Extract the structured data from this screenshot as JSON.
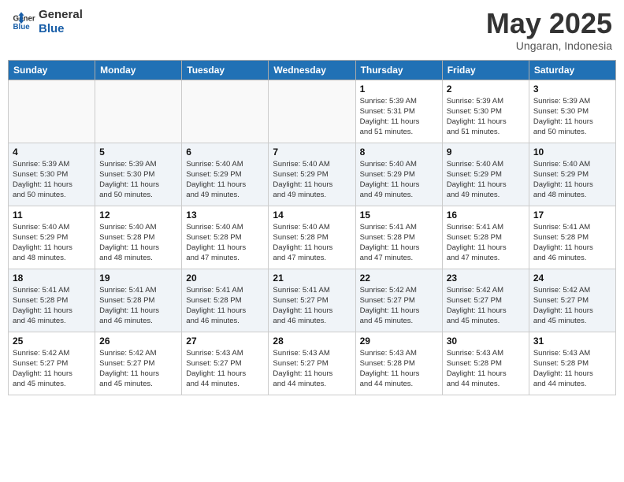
{
  "header": {
    "logo_line1": "General",
    "logo_line2": "Blue",
    "month": "May 2025",
    "location": "Ungaran, Indonesia"
  },
  "weekdays": [
    "Sunday",
    "Monday",
    "Tuesday",
    "Wednesday",
    "Thursday",
    "Friday",
    "Saturday"
  ],
  "weeks": [
    [
      {
        "day": "",
        "info": ""
      },
      {
        "day": "",
        "info": ""
      },
      {
        "day": "",
        "info": ""
      },
      {
        "day": "",
        "info": ""
      },
      {
        "day": "1",
        "info": "Sunrise: 5:39 AM\nSunset: 5:31 PM\nDaylight: 11 hours\nand 51 minutes."
      },
      {
        "day": "2",
        "info": "Sunrise: 5:39 AM\nSunset: 5:30 PM\nDaylight: 11 hours\nand 51 minutes."
      },
      {
        "day": "3",
        "info": "Sunrise: 5:39 AM\nSunset: 5:30 PM\nDaylight: 11 hours\nand 50 minutes."
      }
    ],
    [
      {
        "day": "4",
        "info": "Sunrise: 5:39 AM\nSunset: 5:30 PM\nDaylight: 11 hours\nand 50 minutes."
      },
      {
        "day": "5",
        "info": "Sunrise: 5:39 AM\nSunset: 5:30 PM\nDaylight: 11 hours\nand 50 minutes."
      },
      {
        "day": "6",
        "info": "Sunrise: 5:40 AM\nSunset: 5:29 PM\nDaylight: 11 hours\nand 49 minutes."
      },
      {
        "day": "7",
        "info": "Sunrise: 5:40 AM\nSunset: 5:29 PM\nDaylight: 11 hours\nand 49 minutes."
      },
      {
        "day": "8",
        "info": "Sunrise: 5:40 AM\nSunset: 5:29 PM\nDaylight: 11 hours\nand 49 minutes."
      },
      {
        "day": "9",
        "info": "Sunrise: 5:40 AM\nSunset: 5:29 PM\nDaylight: 11 hours\nand 49 minutes."
      },
      {
        "day": "10",
        "info": "Sunrise: 5:40 AM\nSunset: 5:29 PM\nDaylight: 11 hours\nand 48 minutes."
      }
    ],
    [
      {
        "day": "11",
        "info": "Sunrise: 5:40 AM\nSunset: 5:29 PM\nDaylight: 11 hours\nand 48 minutes."
      },
      {
        "day": "12",
        "info": "Sunrise: 5:40 AM\nSunset: 5:28 PM\nDaylight: 11 hours\nand 48 minutes."
      },
      {
        "day": "13",
        "info": "Sunrise: 5:40 AM\nSunset: 5:28 PM\nDaylight: 11 hours\nand 47 minutes."
      },
      {
        "day": "14",
        "info": "Sunrise: 5:40 AM\nSunset: 5:28 PM\nDaylight: 11 hours\nand 47 minutes."
      },
      {
        "day": "15",
        "info": "Sunrise: 5:41 AM\nSunset: 5:28 PM\nDaylight: 11 hours\nand 47 minutes."
      },
      {
        "day": "16",
        "info": "Sunrise: 5:41 AM\nSunset: 5:28 PM\nDaylight: 11 hours\nand 47 minutes."
      },
      {
        "day": "17",
        "info": "Sunrise: 5:41 AM\nSunset: 5:28 PM\nDaylight: 11 hours\nand 46 minutes."
      }
    ],
    [
      {
        "day": "18",
        "info": "Sunrise: 5:41 AM\nSunset: 5:28 PM\nDaylight: 11 hours\nand 46 minutes."
      },
      {
        "day": "19",
        "info": "Sunrise: 5:41 AM\nSunset: 5:28 PM\nDaylight: 11 hours\nand 46 minutes."
      },
      {
        "day": "20",
        "info": "Sunrise: 5:41 AM\nSunset: 5:28 PM\nDaylight: 11 hours\nand 46 minutes."
      },
      {
        "day": "21",
        "info": "Sunrise: 5:41 AM\nSunset: 5:27 PM\nDaylight: 11 hours\nand 46 minutes."
      },
      {
        "day": "22",
        "info": "Sunrise: 5:42 AM\nSunset: 5:27 PM\nDaylight: 11 hours\nand 45 minutes."
      },
      {
        "day": "23",
        "info": "Sunrise: 5:42 AM\nSunset: 5:27 PM\nDaylight: 11 hours\nand 45 minutes."
      },
      {
        "day": "24",
        "info": "Sunrise: 5:42 AM\nSunset: 5:27 PM\nDaylight: 11 hours\nand 45 minutes."
      }
    ],
    [
      {
        "day": "25",
        "info": "Sunrise: 5:42 AM\nSunset: 5:27 PM\nDaylight: 11 hours\nand 45 minutes."
      },
      {
        "day": "26",
        "info": "Sunrise: 5:42 AM\nSunset: 5:27 PM\nDaylight: 11 hours\nand 45 minutes."
      },
      {
        "day": "27",
        "info": "Sunrise: 5:43 AM\nSunset: 5:27 PM\nDaylight: 11 hours\nand 44 minutes."
      },
      {
        "day": "28",
        "info": "Sunrise: 5:43 AM\nSunset: 5:27 PM\nDaylight: 11 hours\nand 44 minutes."
      },
      {
        "day": "29",
        "info": "Sunrise: 5:43 AM\nSunset: 5:28 PM\nDaylight: 11 hours\nand 44 minutes."
      },
      {
        "day": "30",
        "info": "Sunrise: 5:43 AM\nSunset: 5:28 PM\nDaylight: 11 hours\nand 44 minutes."
      },
      {
        "day": "31",
        "info": "Sunrise: 5:43 AM\nSunset: 5:28 PM\nDaylight: 11 hours\nand 44 minutes."
      }
    ]
  ]
}
